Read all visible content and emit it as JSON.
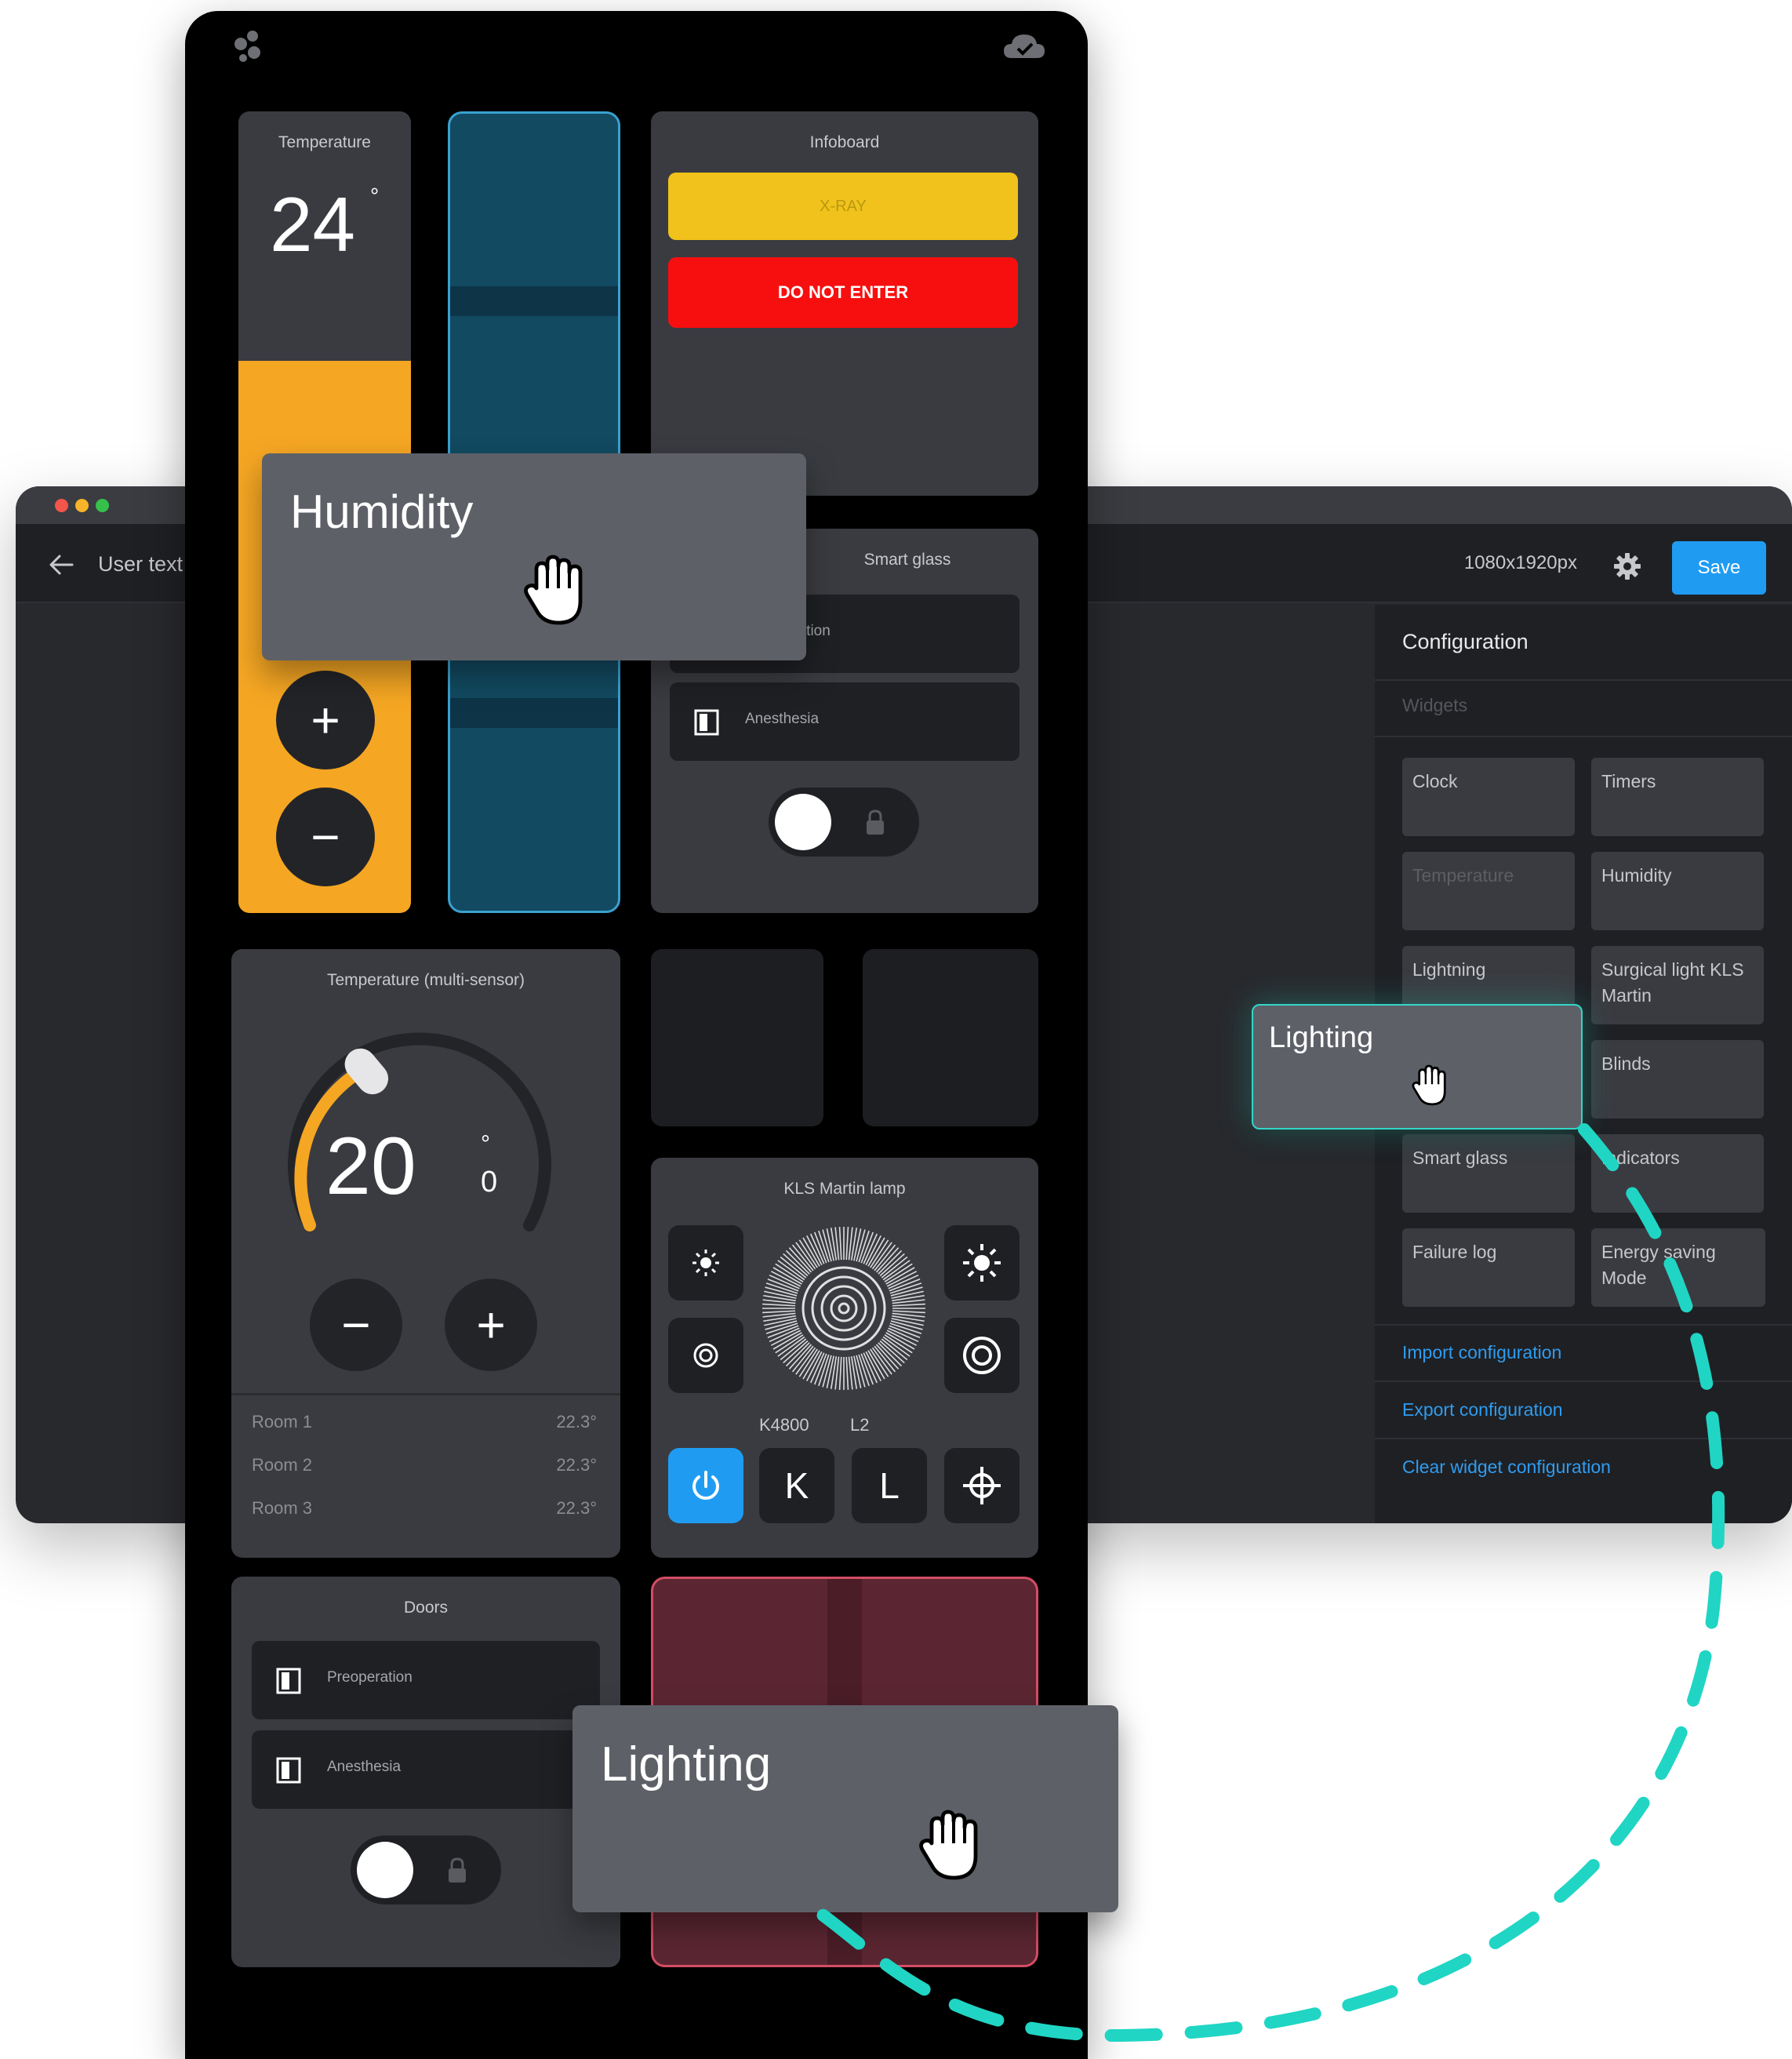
{
  "editor": {
    "title": "User text",
    "resolution": "1080x1920px",
    "save_label": "Save",
    "config": {
      "title": "Configuration",
      "widgets_label": "Widgets",
      "widgets": [
        {
          "label": "Clock",
          "enabled": true
        },
        {
          "label": "Timers",
          "enabled": true
        },
        {
          "label": "Temperature",
          "enabled": false
        },
        {
          "label": "Humidity",
          "enabled": true
        },
        {
          "label": "Lightning",
          "enabled": true
        },
        {
          "label": "Surgical light KLS Martin",
          "enabled": true
        },
        {
          "label": "Blinds",
          "enabled": true
        },
        {
          "label": "Smart glass",
          "enabled": true
        },
        {
          "label": "Indicators",
          "enabled": true
        },
        {
          "label": "Failure log",
          "enabled": true
        },
        {
          "label": "Energy saving Mode",
          "enabled": true
        }
      ],
      "links": [
        "Import configuration",
        "Export configuration",
        "Clear widget configuration"
      ]
    }
  },
  "tablet": {
    "temperature": {
      "label": "Temperature",
      "value": "24",
      "unit": "°",
      "plus": "+",
      "minus": "−"
    },
    "infoboard": {
      "label": "Infoboard",
      "xray": "X-RAY",
      "do_not_enter": "DO NOT ENTER"
    },
    "smart_glass": {
      "label": "Smart glass",
      "doors": [
        "Preoperation",
        "Anesthesia"
      ]
    },
    "temp_multi": {
      "label": "Temperature (multi-sensor)",
      "value": "20",
      "unit": "°",
      "decimal": "0",
      "rooms": [
        {
          "name": "Room 1",
          "value": "22.3°"
        },
        {
          "name": "Room 2",
          "value": "22.3°"
        },
        {
          "name": "Room 3",
          "value": "22.3°"
        }
      ]
    },
    "lamp": {
      "label": "KLS Martin lamp",
      "k_value": "K4800",
      "l_value": "L2",
      "k_btn": "K",
      "l_btn": "L"
    },
    "doors": {
      "label": "Doors",
      "items": [
        "Preoperation",
        "Anesthesia"
      ]
    }
  },
  "drag": {
    "humidity": "Humidity",
    "lighting_small": "Lighting",
    "lighting_big": "Lighting"
  },
  "colors": {
    "accent_blue": "#1f9cf2",
    "teal": "#33d6c7",
    "orange": "#f5a623",
    "yellow": "#f0c21b",
    "red": "#f70f0f"
  }
}
